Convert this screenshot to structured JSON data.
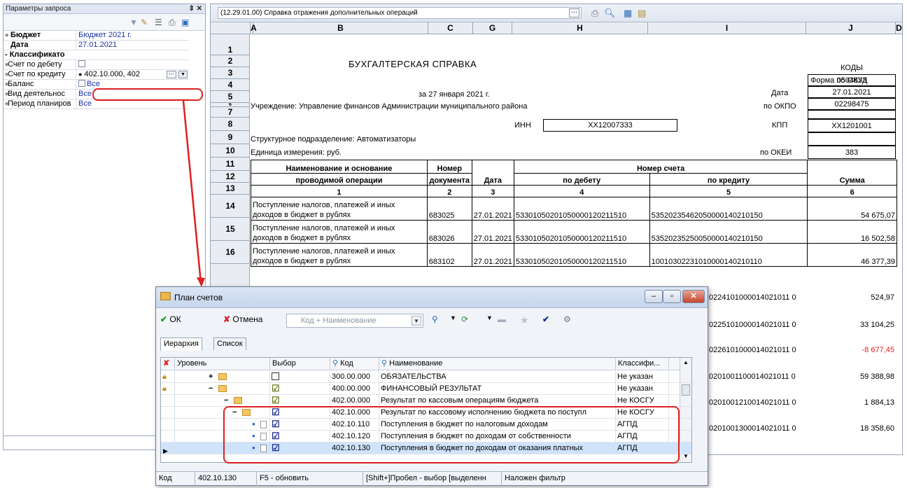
{
  "params_panel": {
    "title": "Параметры запроса",
    "pin_label": "↕ X",
    "rows": [
      {
        "name": "Бюджет",
        "value": "Бюджет 2021 г.",
        "bold": true
      },
      {
        "name": "Дата",
        "value": "27.01.2021",
        "bold": true
      },
      {
        "name": "- Классификато",
        "value": "",
        "group": true
      },
      {
        "name": "Счет по дебету",
        "value": ""
      },
      {
        "name": "Счет по кредиту",
        "value": "402.10.000, 402"
      },
      {
        "name": "Баланс",
        "value": "Все"
      },
      {
        "name": "Вид деятельнос",
        "value": "Все"
      },
      {
        "name": "Период планиров",
        "value": "Все"
      }
    ]
  },
  "report": {
    "title": "(12.29.01.00) Справка отражения дополнительных операций",
    "ellipsis": "···",
    "columns": [
      "A",
      "B",
      "C",
      "G",
      "H",
      "I",
      "J",
      "D"
    ],
    "row_numbers": [
      "1",
      "2",
      "3",
      "4",
      "5",
      "6",
      "7",
      "8",
      "9",
      "10",
      "11",
      "12",
      "13",
      "14",
      "15",
      "16"
    ],
    "header": {
      "doc_title": "БУХГАЛТЕРСКАЯ СПРАВКА",
      "date_line": "за 27 января 2021 г.",
      "institution": "Учреждение: Управление финансов Администрации муниципального района",
      "inn_label": "ИНН",
      "inn_value": "XX12007333",
      "division": "Структурное подразделение: Автоматизаторы",
      "unit": "Единица измерения: руб.",
      "codes_label": "КОДЫ",
      "okud_label": "Форма по ОКУД",
      "okud_value": "0504833",
      "date_label": "Дата",
      "date_value": "27.01.2021",
      "okpo_label": "по ОКПО",
      "okpo_value": "02298475",
      "kpp_label": "КПП",
      "kpp_value": "XX1201001",
      "okei_label": "по ОКЕИ",
      "okei_value": "383"
    },
    "table_header": {
      "name_1": "Наименование и основание",
      "name_2": "проводимой операции",
      "doc_no_1": "Номер",
      "doc_no_2": "документа",
      "date": "Дата",
      "account": "Номер счета",
      "debit": "по дебету",
      "credit": "по кредиту",
      "sum": "Сумма",
      "n1": "1",
      "n2": "2",
      "n3": "3",
      "n4": "4",
      "n5": "5",
      "n6": "6"
    },
    "rows": [
      {
        "name1": "Поступление налогов, платежей и иных",
        "name2": "доходов в бюджет в рублях",
        "doc": "683025",
        "date": "27.01.2021",
        "debit": "53301050201050000120211510",
        "credit": "53520235462050000140210150",
        "sum": "54 675,07"
      },
      {
        "name1": "Поступление налогов, платежей и иных",
        "name2": "доходов в бюджет в рублях",
        "doc": "683026",
        "date": "27.01.2021",
        "debit": "53301050201050000120211510",
        "credit": "53520235250050000140210150",
        "sum": "16 502,58"
      },
      {
        "name1": "Поступление налогов, платежей и иных",
        "name2": "доходов в бюджет в рублях",
        "doc": "683102",
        "date": "27.01.2021",
        "debit": "53301050201050000120211510",
        "credit": "10010302231010000140210110",
        "sum": "46 377,39"
      }
    ],
    "hidden_rows": [
      {
        "credit": "0224101000014021011 0",
        "sum": "524,97"
      },
      {
        "credit": "0225101000014021011 0",
        "sum": "33 104,25"
      },
      {
        "credit": "0226101000014021011 0",
        "sum": "-8 677,45",
        "negative": true
      },
      {
        "credit": "0201001100014021011 0",
        "sum": "59 388,98"
      },
      {
        "credit": "0201001210014021011 0",
        "sum": "1 884,13"
      },
      {
        "credit": "0201001300014021011 0",
        "sum": "18 358,60"
      }
    ]
  },
  "dialog": {
    "title": "План счетов",
    "ok_label": "ОК",
    "cancel_label": "Отмена",
    "search_placeholder": "Код + Наименование",
    "tabs": [
      "Иерархия",
      "Список"
    ],
    "columns": {
      "level": "Уровень",
      "choice": "Выбор",
      "code": "Код",
      "name": "Наименование",
      "classif": "Классифи..."
    },
    "rows": [
      {
        "expander": "+",
        "code": "300.00.000",
        "name": "ОБЯЗАТЕЛЬСТВА",
        "classif": "Не указан"
      },
      {
        "expander": "−",
        "code": "400.00.000",
        "name": "ФИНАНСОВЫЙ РЕЗУЛЬТАТ",
        "classif": "Не указан"
      },
      {
        "expander": "−",
        "code": "402.00.000",
        "name": "Результат по кассовым  операциям бюджета",
        "classif": "Не КОСГУ"
      },
      {
        "expander": "−",
        "code": "402.10.000",
        "name": "Результат по кассовому исполнению бюджета по поступл",
        "classif": "Не КОСГУ"
      },
      {
        "expander": "",
        "code": "402.10.110",
        "name": "Поступления в бюджет по налоговым доходам",
        "classif": "АГПД"
      },
      {
        "expander": "",
        "code": "402.10.120",
        "name": "Поступления в бюджет по доходам от собственности",
        "classif": "АГПД"
      },
      {
        "expander": "",
        "code": "402.10.130",
        "name": "Поступления в бюджет по доходам от оказания  платных",
        "classif": "АГПД"
      }
    ],
    "status": {
      "label": "Код",
      "code": "402.10.130",
      "refresh": "F5 - обновить",
      "hint": "[Shift+]Пробел - выбор [выделенн",
      "filter": "Наложен фильтр"
    }
  },
  "colors": {
    "accent_red": "#e02020",
    "value_blue": "#1a33a6",
    "negative": "#e02020",
    "selection": "#cfe3fb"
  }
}
